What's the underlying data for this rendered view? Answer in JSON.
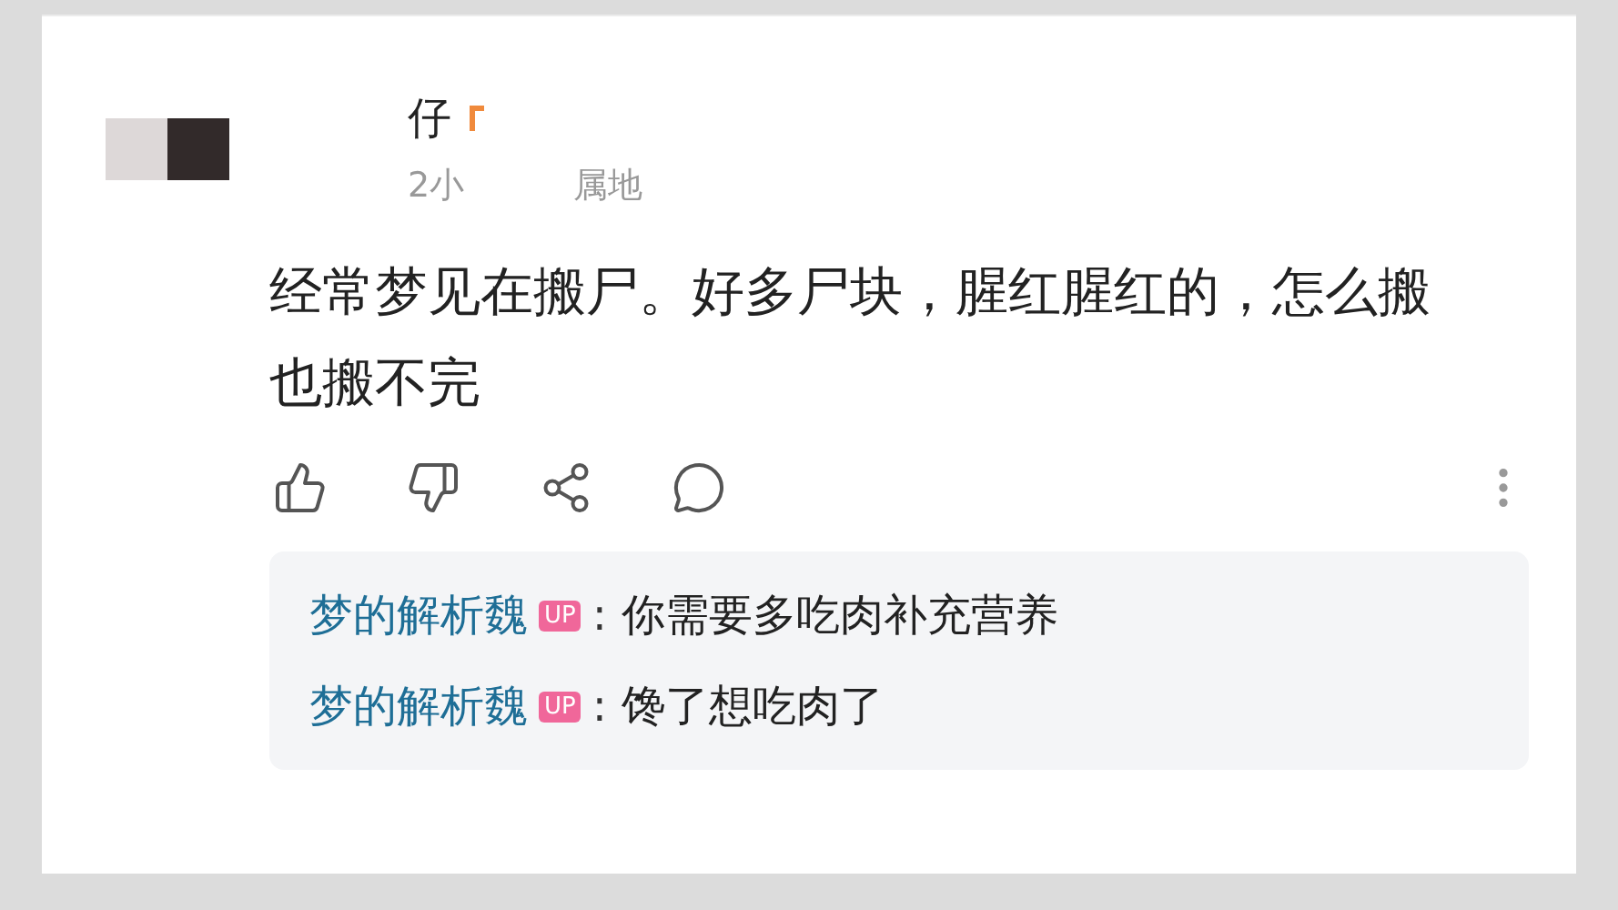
{
  "comment": {
    "user": {
      "name": "仔"
    },
    "meta": [
      "2小",
      "属地"
    ],
    "text": "经常梦见在搬尸。好多尸块，腥红腥红的，怎么搬也搬不完"
  },
  "replies": [
    {
      "author": "梦的解析魏",
      "badge": "UP",
      "separator": ":",
      "text": "你需要多吃肉补充营养"
    },
    {
      "author": "梦的解析魏",
      "badge": "UP",
      "separator": ":",
      "text": "馋了想吃肉了"
    }
  ]
}
